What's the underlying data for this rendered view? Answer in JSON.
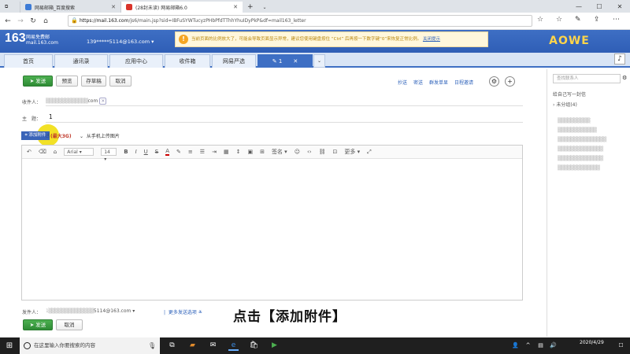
{
  "browser": {
    "tabs": [
      {
        "title": "网易邮箱_百度搜索",
        "favicon_color": "#3d7bd6"
      },
      {
        "title": "(28封未读) 网易邮箱6.0",
        "favicon_color": "#d9342b"
      }
    ],
    "new_tab": "+",
    "url_domain": "https://mail.163.com",
    "url_path": "/js6/main.jsp?sid=IBFuSYWTucyzPHbPfdTThhYhuIDyPkP&df=mail163_letter"
  },
  "mail_header": {
    "logo_number": "163",
    "logo_title": "网易免费邮",
    "logo_domain": "mail.163.com",
    "account": "139*****5114@163.com ▾",
    "notice_text": "当前页面的比例放大了，可能会导致页面显示异常，建议您使用键盘按住 “Ctrl” 后再按一下数字键“0”来恢复正常比例。",
    "notice_link": "关闭提示"
  },
  "nav_tabs": [
    "首页",
    "通讯录",
    "应用中心",
    "收件箱",
    "网易严选"
  ],
  "compose_tab_label": "1",
  "compose": {
    "send_label": "发送",
    "preview_label": "预览",
    "draft_label": "存草稿",
    "cancel_label": "取消",
    "top_links": [
      "抄送",
      "密送",
      "群发单显",
      "日程邀请"
    ],
    "recipient_label": "收件人：",
    "recipient_value": "com",
    "subject_label": "主　题：",
    "subject_value": "1",
    "attach_label": "添加附件",
    "attach_limit": "(最大3G)",
    "phone_upload": "从手机上传图片",
    "font_name": "Arial",
    "font_size": "14",
    "signature": "签名",
    "more": "更多",
    "sender_label": "发件人：",
    "sender_value": "5114@163.com",
    "more_options": "更多发送选项"
  },
  "right_panel": {
    "search_placeholder": "查找联系人",
    "items": [
      "给自己写一封信",
      "未分组(4)"
    ]
  },
  "caption": "点击【添加附件】",
  "taskbar": {
    "search_placeholder": "在这里输入你要搜索的内容",
    "time": "",
    "date": "2020/4/29"
  }
}
